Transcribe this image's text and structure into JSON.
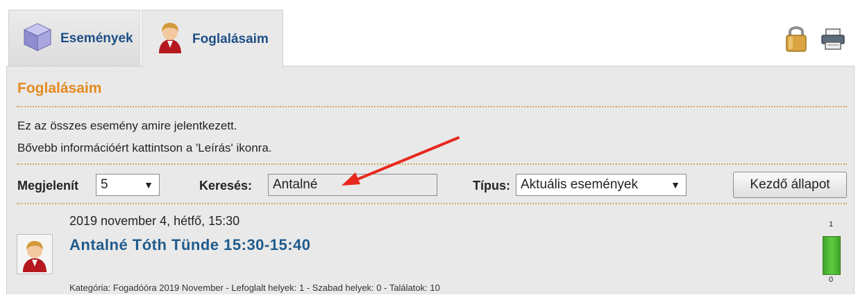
{
  "tabs": [
    {
      "label": "Események",
      "icon": "cube-icon",
      "active": false
    },
    {
      "label": "Foglalásaim",
      "icon": "user-icon",
      "active": true
    }
  ],
  "toolbar": {
    "lock_icon": "lock-icon",
    "print_icon": "printer-icon"
  },
  "panel": {
    "title": "Foglalásaim",
    "info_line1": "Ez az összes esemény amire jelentkezett.",
    "info_line2": "Bővebb információért kattintson a 'Leírás' ikonra."
  },
  "controls": {
    "show_label": "Megjelenít",
    "show_value": "5",
    "search_label": "Keresés:",
    "search_value": "Antalné",
    "type_label": "Típus:",
    "type_value": "Aktuális események",
    "reset_button": "Kezdő állapot"
  },
  "event": {
    "date": "2019 november 4, hétfő, 15:30",
    "title": "Antalné Tóth Tünde 15:30-15:40",
    "meta": "Kategória: Fogadóóra 2019 November - Lefoglalt helyek: 1 - Szabad helyek: 0 - Találatok: 10",
    "capacity_max": "1",
    "capacity_min": "0",
    "fill_fraction": 1.0
  },
  "annotation": {
    "arrow_color": "#e8281e"
  },
  "colors": {
    "heading": "#e58a1f",
    "link": "#1f5b8c",
    "tab_text": "#1f4f86",
    "bar": "#4cbb35"
  }
}
